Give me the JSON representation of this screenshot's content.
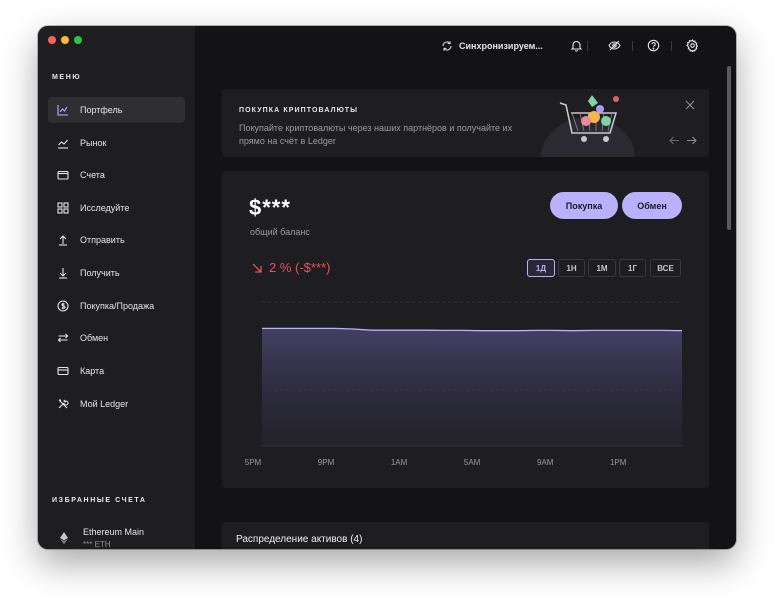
{
  "sidebar": {
    "menu_title": "МЕНЮ",
    "items": [
      {
        "label": "Портфель",
        "icon": "portfolio-chart-icon",
        "active": true
      },
      {
        "label": "Рынок",
        "icon": "market-chart-icon"
      },
      {
        "label": "Счета",
        "icon": "wallet-icon"
      },
      {
        "label": "Исследуйте",
        "icon": "grid-icon"
      },
      {
        "label": "Отправить",
        "icon": "arrow-up-icon"
      },
      {
        "label": "Получить",
        "icon": "arrow-down-icon"
      },
      {
        "label": "Покупка/Продажа",
        "icon": "dollar-icon"
      },
      {
        "label": "Обмен",
        "icon": "swap-icon"
      },
      {
        "label": "Карта",
        "icon": "card-icon"
      },
      {
        "label": "Мой Ledger",
        "icon": "tools-icon"
      }
    ],
    "favorites_title": "ИЗБРАННЫЕ СЧЕТА",
    "favorites": [
      {
        "name": "Ethereum Main",
        "balance": "*** ETH",
        "icon": "ethereum-icon"
      }
    ]
  },
  "topbar": {
    "sync_label": "Синхронизируем...",
    "icons": [
      "bell-icon",
      "eye-off-icon",
      "help-icon",
      "settings-icon"
    ]
  },
  "banner": {
    "title": "ПОКУПКА КРИПТОВАЛЮТЫ",
    "text": "Покупайте криптовалюты через наших партнёров и получайте их прямо на счёт в Ledger"
  },
  "portfolio": {
    "balance": "$***",
    "balance_label": "общий баланс",
    "buy_label": "Покупка",
    "swap_label": "Обмен",
    "change": "2 % (-$***)",
    "ranges": [
      {
        "label": "1Д",
        "active": true
      },
      {
        "label": "1Н",
        "active": false
      },
      {
        "label": "1М",
        "active": false
      },
      {
        "label": "1Г",
        "active": false
      },
      {
        "label": "ВСЕ",
        "active": false
      }
    ]
  },
  "distribution": {
    "title": "Распределение активов (4)"
  },
  "colors": {
    "accent": "#bbb0ff",
    "negative": "#ef4e62",
    "background": "#131316",
    "panel": "#1e1e21"
  },
  "chart_data": {
    "type": "area",
    "x_tick_labels": [
      "5PM",
      "9PM",
      "1AM",
      "5AM",
      "9AM",
      "1PM"
    ],
    "x": [
      "5PM",
      "6PM",
      "7PM",
      "8PM",
      "9PM",
      "10PM",
      "11PM",
      "12AM",
      "1AM",
      "2AM",
      "3AM",
      "4AM",
      "5AM",
      "6AM",
      "7AM",
      "8AM",
      "9AM",
      "10AM",
      "11AM",
      "12PM",
      "1PM",
      "2PM",
      "3PM",
      "4PM"
    ],
    "values": [
      0.98,
      0.98,
      0.98,
      0.98,
      0.98,
      0.975,
      0.965,
      0.965,
      0.965,
      0.965,
      0.963,
      0.963,
      0.961,
      0.961,
      0.961,
      0.963,
      0.963,
      0.961,
      0.963,
      0.963,
      0.963,
      0.963,
      0.963,
      0.961
    ],
    "ylim": [
      0,
      1.2
    ],
    "grid": true,
    "series_color": "#bbb0ff",
    "note_values_hidden": false
  }
}
